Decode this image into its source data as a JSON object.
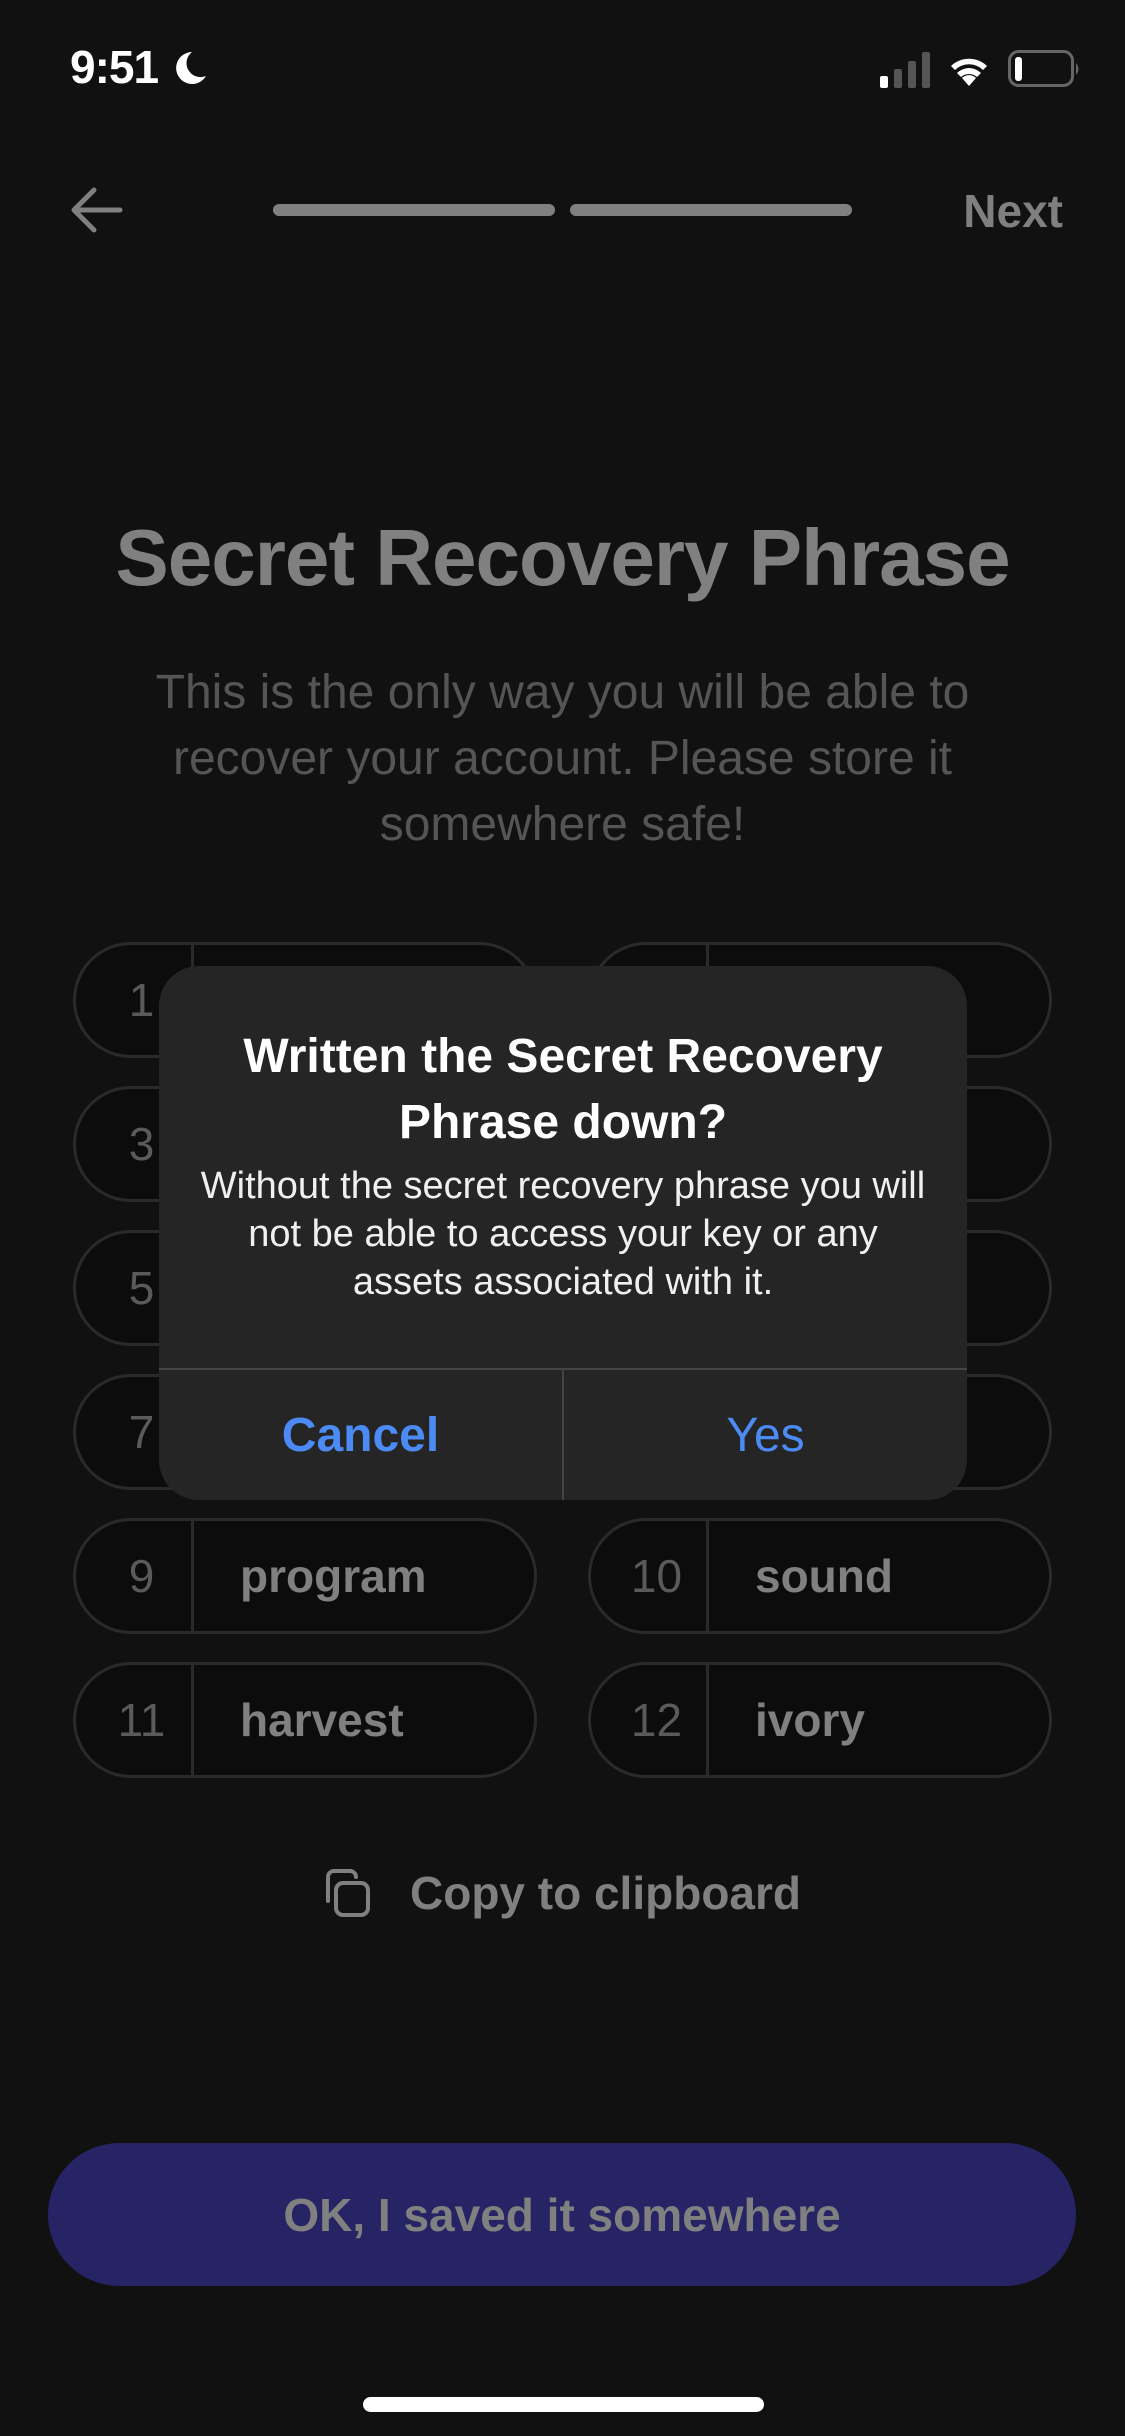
{
  "status_bar": {
    "time": "9:51",
    "icons": [
      "moon-icon",
      "cellular-signal-icon",
      "wifi-icon",
      "battery-icon"
    ]
  },
  "header": {
    "back_icon": "arrow-left-icon",
    "progress": {
      "steps_total": 2,
      "steps_filled": 2
    },
    "next_label": "Next"
  },
  "main": {
    "title": "Secret Recovery Phrase",
    "subtitle": "This is the only way you will be able to recover your account. Please store it somewhere safe!",
    "words": [
      {
        "index": "1",
        "word": ""
      },
      {
        "index": "",
        "word": ""
      },
      {
        "index": "3",
        "word": ""
      },
      {
        "index": "",
        "word": ""
      },
      {
        "index": "5",
        "word": ""
      },
      {
        "index": "",
        "word": ""
      },
      {
        "index": "7",
        "word": ""
      },
      {
        "index": "",
        "word": ""
      },
      {
        "index": "9",
        "word": "program"
      },
      {
        "index": "10",
        "word": "sound"
      },
      {
        "index": "11",
        "word": "harvest"
      },
      {
        "index": "12",
        "word": "ivory"
      }
    ],
    "copy_label": "Copy to clipboard",
    "copy_icon": "copy-icon",
    "primary_button": "OK, I saved it somewhere"
  },
  "dialog": {
    "title": "Written the Secret Recovery Phrase down?",
    "message": "Without the secret recovery phrase you will not be able to access your key or any assets associated with it.",
    "cancel_label": "Cancel",
    "confirm_label": "Yes"
  },
  "colors": {
    "background": "#111111",
    "dialog_bg": "#252525",
    "dialog_button": "#4c8bf5",
    "primary_button_bg": "#272466",
    "muted_text": "#808080"
  }
}
